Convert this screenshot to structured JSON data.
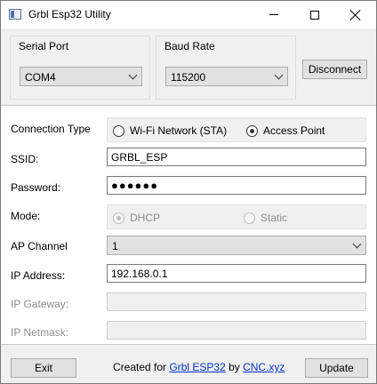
{
  "window": {
    "title": "Grbl Esp32 Utility",
    "icon": "app-window-icon",
    "controls": [
      "minimize-icon",
      "maximize-icon",
      "close-icon"
    ]
  },
  "serial_port": {
    "label": "Serial Port",
    "value": "COM4"
  },
  "baud_rate": {
    "label": "Baud Rate",
    "value": "115200"
  },
  "disconnect_label": "Disconnect",
  "form": {
    "connection_type": {
      "label": "Connection Type",
      "options": [
        "Wi-Fi Network (STA)",
        "Access Point"
      ],
      "selected": "Access Point"
    },
    "ssid": {
      "label": "SSID:",
      "value": "GRBL_ESP"
    },
    "password": {
      "label": "Password:",
      "value": "●●●●●●"
    },
    "mode": {
      "label": "Mode:",
      "options": [
        "DHCP",
        "Static"
      ],
      "selected": "DHCP"
    },
    "ap_channel": {
      "label": "AP Channel",
      "value": "1"
    },
    "ip_address": {
      "label": "IP Address:",
      "value": "192.168.0.1"
    },
    "ip_gateway": {
      "label": "IP Gateway:",
      "value": ""
    },
    "ip_netmask": {
      "label": "IP Netmask:",
      "value": ""
    }
  },
  "footer": {
    "exit_label": "Exit",
    "update_label": "Update",
    "credit_prefix": "Created for ",
    "credit_link1": "Grbl ESP32",
    "credit_mid": " by ",
    "credit_link2": "CNC.xyz"
  },
  "colors": {
    "link": "#0033cc",
    "disabled_text": "#8d8d8d",
    "panel_bg": "#f0f0f0"
  }
}
